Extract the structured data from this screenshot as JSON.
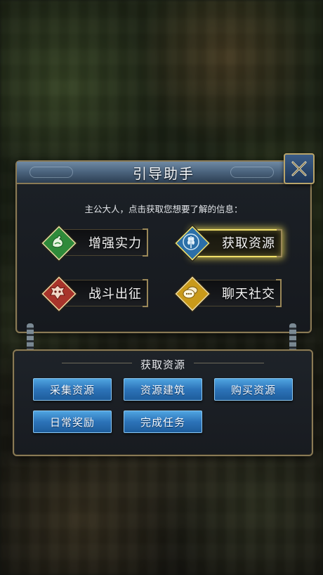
{
  "dialog": {
    "title": "引导助手",
    "subtitle": "主公大人，点击获取您想要了解的信息：",
    "categories": [
      {
        "label": "增强实力",
        "icon": "strength-arm-icon",
        "color": "#2f8a3a"
      },
      {
        "label": "获取资源",
        "icon": "wheat-resource-icon",
        "color": "#2b6fa8",
        "selected": true
      },
      {
        "label": "战斗出征",
        "icon": "war-beast-icon",
        "color": "#a8342b"
      },
      {
        "label": "聊天社交",
        "icon": "chat-bubble-icon",
        "color": "#c99a1a"
      }
    ]
  },
  "section": {
    "title": "获取资源",
    "buttons": [
      "采集资源",
      "资源建筑",
      "购买资源",
      "日常奖励",
      "完成任务"
    ]
  },
  "colors": {
    "accent_gold": "#f2e06a",
    "frame_gold": "#8a7a55",
    "button_blue": "#2c73b8"
  }
}
